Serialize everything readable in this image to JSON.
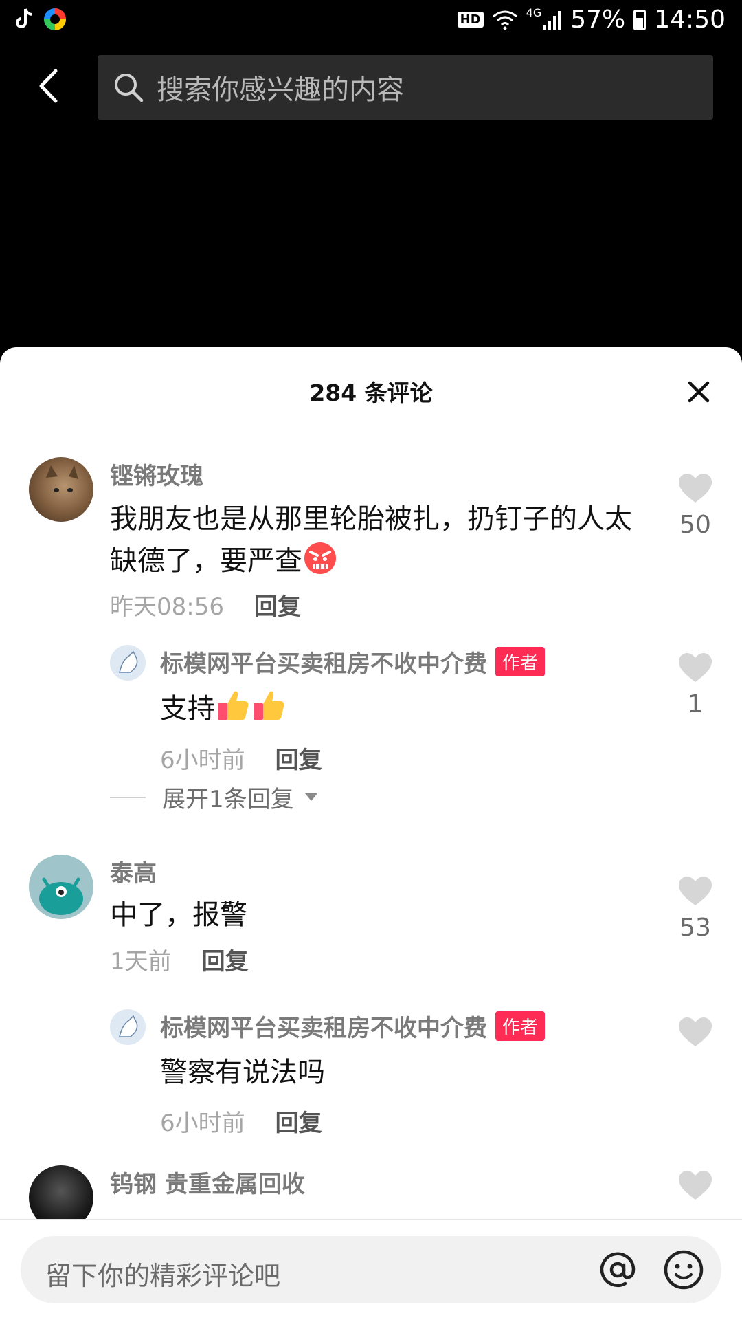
{
  "status_bar": {
    "hd": "HD",
    "network": "4G",
    "battery": "57%",
    "time": "14:50",
    "icons": [
      "tiktok-icon",
      "colorful-app-icon",
      "wifi-icon",
      "signal-icon",
      "battery-icon"
    ]
  },
  "header": {
    "search_placeholder": "搜索你感兴趣的内容",
    "icons": [
      "back-icon",
      "search-icon"
    ]
  },
  "sheet": {
    "title": "284 条评论",
    "close_icon": "close-icon"
  },
  "comments": [
    {
      "username": "铿锵玫瑰",
      "text": "我朋友也是从那里轮胎被扎，扔钉子的人太缺德了，要严查",
      "emoji": "angry-face-icon",
      "time": "昨天08:56",
      "reply_label": "回复",
      "likes": "50",
      "replies": [
        {
          "username": "标模网平台买卖租房不收中介费",
          "tag": "作者",
          "text": "支持",
          "emoji": "thumbs-up-icon",
          "time": "6小时前",
          "reply_label": "回复",
          "likes": "1"
        }
      ],
      "expand_label": "展开1条回复"
    },
    {
      "username": "泰高",
      "text": "中了，报警",
      "time": "1天前",
      "reply_label": "回复",
      "likes": "53",
      "replies": [
        {
          "username": "标模网平台买卖租房不收中介费",
          "tag": "作者",
          "text": "警察有说法吗",
          "time": "6小时前",
          "reply_label": "回复",
          "likes": ""
        }
      ]
    },
    {
      "username": "钨钢 贵重金属回收",
      "likes": ""
    }
  ],
  "bottom_bar": {
    "input_placeholder": "留下你的精彩评论吧",
    "icons": [
      "at-icon",
      "emoji-icon"
    ]
  },
  "colors": {
    "accent": "#fe2c55",
    "sheet_bg": "#ffffff",
    "top_bg": "#000000",
    "search_bg": "#2b2b2b"
  }
}
